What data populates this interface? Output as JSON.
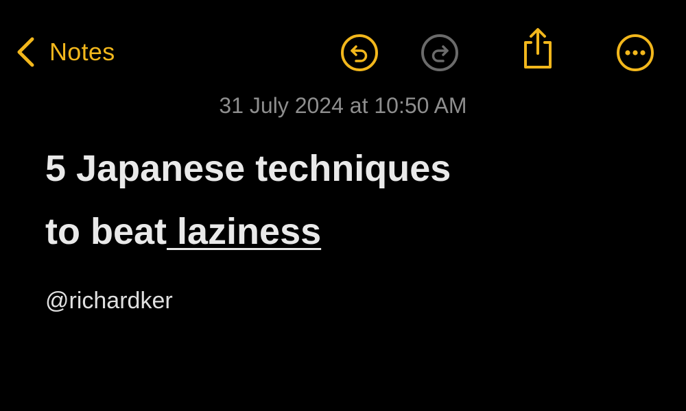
{
  "nav": {
    "back_label": "Notes",
    "icons": {
      "back": "chevron-left-icon",
      "undo": "undo-icon",
      "redo": "redo-icon",
      "share": "share-icon",
      "more": "more-icon"
    },
    "accent_color": "#f2b71c",
    "disabled_color": "#6b6b6b",
    "redo_disabled": true
  },
  "note": {
    "timestamp": "31 July 2024 at 10:50 AM",
    "title_line1": "5 Japanese techniques",
    "title_line2_prefix": "to beat",
    "title_line2_link": " laziness",
    "author": "@richardker"
  }
}
